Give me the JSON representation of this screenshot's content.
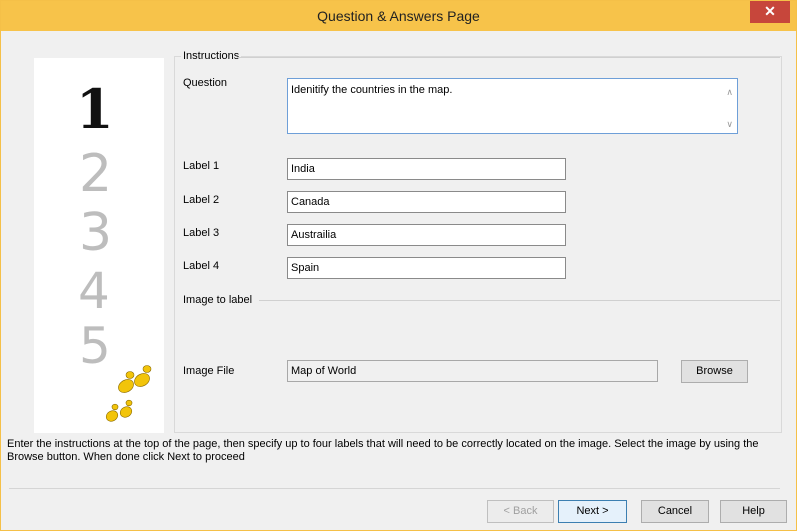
{
  "window": {
    "title": "Question & Answers Page",
    "close_icon": "close-icon",
    "accent": "#f7c34a",
    "close_color": "#c7463b"
  },
  "steps": {
    "numbers": [
      "1",
      "2",
      "3",
      "4",
      "5"
    ],
    "current": "1",
    "footprints_icon": "footprints-icon"
  },
  "instructions_section": {
    "title": "Instructions",
    "question_label": "Question",
    "question_value": "Idenitify the countries in the map.",
    "labels": [
      {
        "label": "Label 1",
        "value": "India"
      },
      {
        "label": "Label 2",
        "value": "Canada"
      },
      {
        "label": "Label 3",
        "value": "Austrailia"
      },
      {
        "label": "Label 4",
        "value": "Spain"
      }
    ]
  },
  "image_section": {
    "title": "Image to label",
    "file_label": "Image File",
    "file_value": "Map of World",
    "browse_label": "Browse"
  },
  "help_text": "Enter the instructions at the top of the page, then specify up to four labels that will need to be correctly located on the image. Select the image by using the Browse button. When done click Next to proceed",
  "buttons": {
    "back": "< Back",
    "next": "Next >",
    "cancel": "Cancel",
    "help": "Help"
  }
}
